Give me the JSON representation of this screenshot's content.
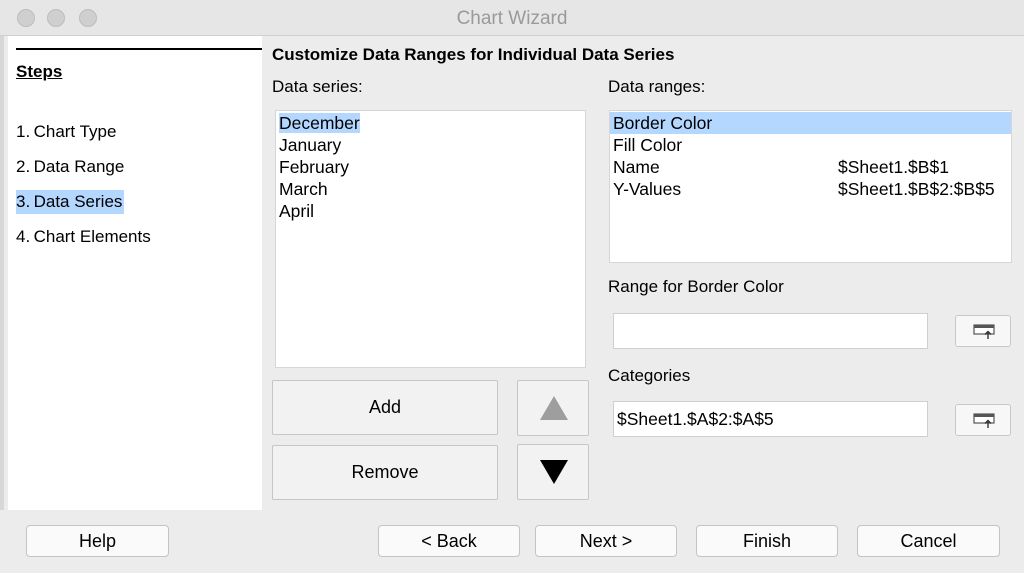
{
  "window": {
    "title": "Chart Wizard"
  },
  "steps": {
    "title": "Steps",
    "items": [
      {
        "label": "1. Chart Type"
      },
      {
        "label": "2. Data Range"
      },
      {
        "label": "3. Data Series"
      },
      {
        "label": "4. Chart Elements"
      }
    ],
    "selected_index": 2
  },
  "main": {
    "heading": "Customize Data Ranges for Individual Data Series",
    "data_series_label": "Data series:",
    "data_series": [
      "December",
      "January",
      "February",
      "March",
      "April"
    ],
    "selected_series": "December",
    "data_ranges_label": "Data ranges:",
    "data_ranges": [
      {
        "role": "Border Color",
        "range": ""
      },
      {
        "role": "Fill Color",
        "range": ""
      },
      {
        "role": "Name",
        "range": "$Sheet1.$B$1"
      },
      {
        "role": "Y-Values",
        "range": "$Sheet1.$B$2:$B$5"
      }
    ],
    "selected_range_role": "Border Color",
    "range_for_label": "Range for Border Color",
    "range_value": "",
    "categories_label": "Categories",
    "categories_value": "$Sheet1.$A$2:$A$5",
    "add_label": "Add",
    "remove_label": "Remove"
  },
  "footer": {
    "help": "Help",
    "back": "< Back",
    "next": "Next >",
    "finish": "Finish",
    "cancel": "Cancel"
  },
  "colors": {
    "selection": "#b3d7ff",
    "window_bg": "#ececec",
    "panel_bg": "#ffffff"
  },
  "icons": {
    "move_up": "triangle-up-icon",
    "move_down": "triangle-down-icon",
    "range_picker": "shrink-dialog-icon"
  }
}
